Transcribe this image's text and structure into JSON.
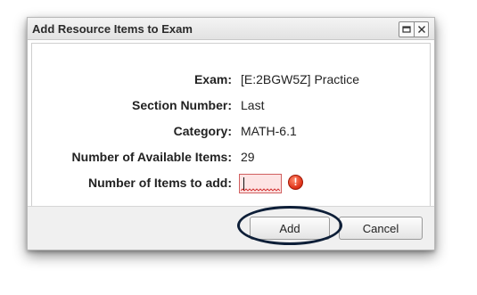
{
  "dialog": {
    "title": "Add Resource Items to Exam"
  },
  "form": {
    "fields": [
      {
        "label": "Exam:",
        "value": "[E:2BGW5Z] Practice"
      },
      {
        "label": "Section Number:",
        "value": "Last"
      },
      {
        "label": "Category:",
        "value": "MATH-6.1"
      },
      {
        "label": "Number of Available Items:",
        "value": "29"
      }
    ],
    "items_to_add": {
      "label": "Number of Items to add:",
      "value": "",
      "state": "invalid"
    }
  },
  "buttons": {
    "add": "Add",
    "cancel": "Cancel"
  },
  "icons": {
    "restore": "restore-icon",
    "close": "close-icon",
    "error": "error-icon"
  },
  "colors": {
    "error_fill": "#fde4e4",
    "error_border": "#d06060",
    "error_icon": "#e0341a",
    "highlight_ring": "#0e1f38"
  }
}
